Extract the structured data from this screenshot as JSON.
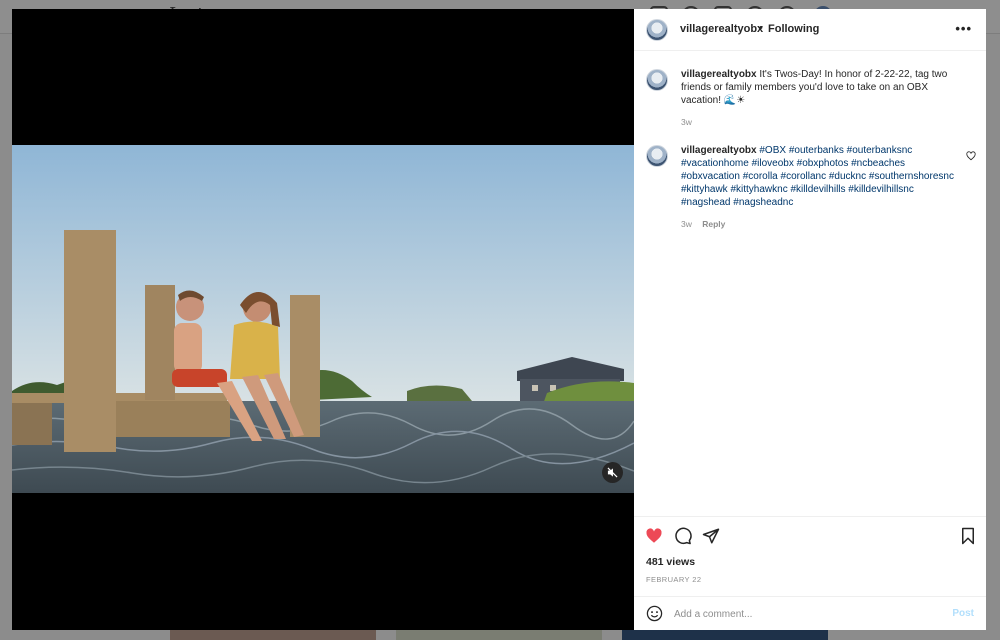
{
  "background": {
    "logo": "Insta"
  },
  "post": {
    "username": "villagerealtyobx",
    "separator": "•",
    "follow_status": "Following",
    "more_icon": "more-horizontal-icon",
    "caption": {
      "username": "villagerealtyobx",
      "text": "It's Twos-Day! In honor of 2-22-22, tag two friends or family members you'd love to take on an OBX vacation! 🌊☀",
      "time": "3w"
    },
    "comment": {
      "username": "villagerealtyobx",
      "text": "#OBX #outerbanks #outerbanksnc #vacationhome #iloveobx #obxphotos #ncbeaches #obxvacation #corolla #corollanc #ducknc #southernshoresnc #kittyhawk #kittyhawknc #killdevilhills #killdevilhillsnc #nagshead #nagsheadnc",
      "time": "3w",
      "reply_label": "Reply"
    },
    "views": "481 views",
    "date": "FEBRUARY 22",
    "add_comment_placeholder": "Add a comment...",
    "post_button": "Post",
    "liked": true,
    "colors": {
      "like": "#ed4956",
      "hashtag": "#00376b",
      "post_disabled": "#b2dffc",
      "meta": "#8e8e8e"
    }
  },
  "media": {
    "muted": true,
    "mute_icon": "speaker-muted-icon"
  }
}
